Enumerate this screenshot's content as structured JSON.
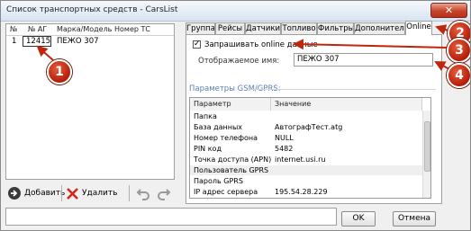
{
  "window": {
    "title": "Список транспортных средств - CarsList"
  },
  "car_list": {
    "columns": [
      "№",
      "№ АГ",
      "Марка/Модель",
      "Номер ТС"
    ],
    "rows": [
      {
        "num": "1",
        "ag": "12415",
        "model": "ПЕЖО 307",
        "plate": ""
      }
    ]
  },
  "toolbar": {
    "add_label": "Добавить",
    "delete_label": "Удалить"
  },
  "tabs": [
    "Группа",
    "Рейсы",
    "Датчики",
    "Топливо",
    "Фильтры",
    "Дополнительно",
    "Online"
  ],
  "online": {
    "request_label": "Запрашивать online данные",
    "request_checked": true,
    "display_name_label": "Отображаемое имя:",
    "display_name_value": "ПЕЖО 307",
    "gsm_group_title": "Параметры GSM/GPRS:",
    "param_headers": [
      "Параметр",
      "Значение"
    ],
    "params": [
      {
        "name": "Папка",
        "value": ""
      },
      {
        "name": "База данных",
        "value": "АвтографТест.atg"
      },
      {
        "name": "Номер телефона",
        "value": "NULL"
      },
      {
        "name": "PIN код",
        "value": "5482"
      },
      {
        "name": "Точка доступа (APN)",
        "value": "internet.usi.ru"
      },
      {
        "name": "Пользователь GPRS",
        "value": ""
      },
      {
        "name": "Пароль GPRS",
        "value": ""
      },
      {
        "name": "IP адрес сервера",
        "value": "195.54.28.229"
      }
    ]
  },
  "dialog": {
    "ok_label": "OK",
    "cancel_label": "Отмена"
  },
  "callouts": [
    "1",
    "2",
    "3",
    "4"
  ],
  "colors": {
    "callout_red": "#c0260d",
    "group_title_blue": "#5b7db6"
  }
}
